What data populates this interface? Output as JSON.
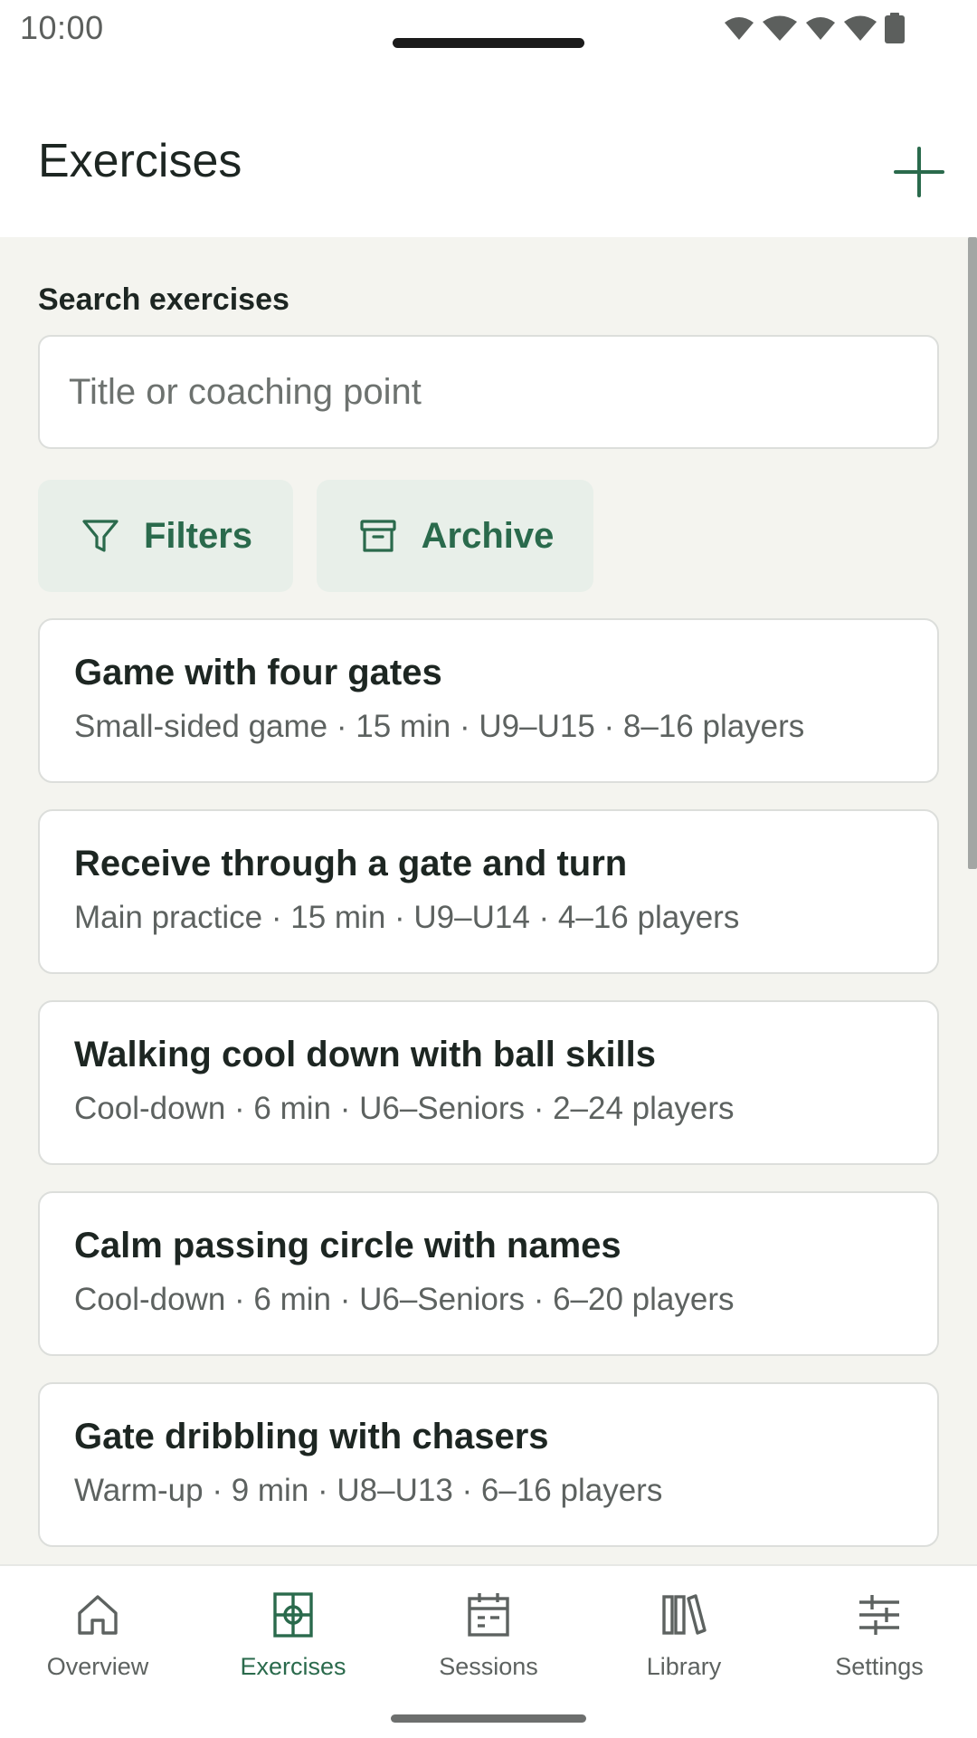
{
  "status_bar": {
    "time": "10:00"
  },
  "header": {
    "title": "Exercises",
    "add_icon": "plus-icon"
  },
  "search": {
    "label": "Search exercises",
    "placeholder": "Title or coaching point",
    "value": ""
  },
  "actions": {
    "filters_label": "Filters",
    "filters_icon": "filter-icon",
    "archive_label": "Archive",
    "archive_icon": "archive-icon"
  },
  "exercises": [
    {
      "title": "Game with four gates",
      "meta": "Small-sided game · 15 min · U9–U15 · 8–16 players"
    },
    {
      "title": "Receive through a gate and turn",
      "meta": "Main practice · 15 min · U9–U14 · 4–16 players"
    },
    {
      "title": "Walking cool down with ball skills",
      "meta": "Cool-down · 6 min · U6–Seniors · 2–24 players"
    },
    {
      "title": "Calm passing circle with names",
      "meta": "Cool-down · 6 min · U6–Seniors · 6–20 players"
    },
    {
      "title": "Gate dribbling with chasers",
      "meta": "Warm-up · 9 min · U8–U13 · 6–16 players"
    }
  ],
  "bottom_nav": {
    "active": "Exercises",
    "items": [
      {
        "label": "Overview",
        "icon": "home-icon"
      },
      {
        "label": "Exercises",
        "icon": "pitch-icon"
      },
      {
        "label": "Sessions",
        "icon": "calendar-icon"
      },
      {
        "label": "Library",
        "icon": "books-icon"
      },
      {
        "label": "Settings",
        "icon": "sliders-icon"
      }
    ]
  },
  "colors": {
    "accent": "#2a6a4c",
    "background": "#f4f4ef",
    "chip_background": "#e8efe9",
    "card_border": "#dcdedb",
    "text_primary": "#1d2622",
    "text_secondary": "#5d6260"
  }
}
